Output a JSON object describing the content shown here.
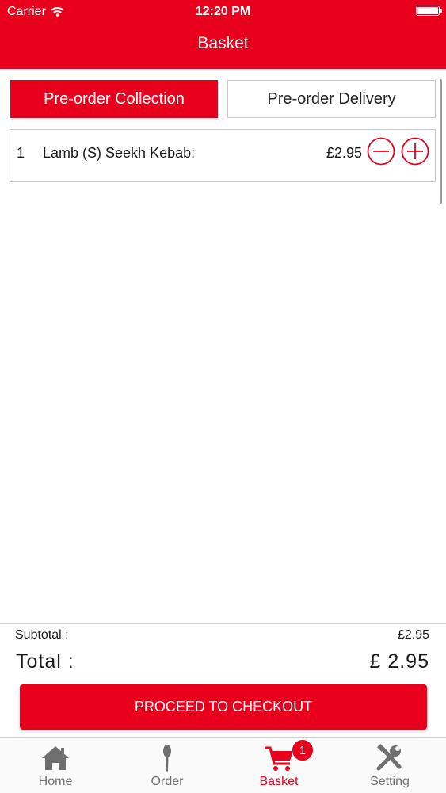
{
  "status_bar": {
    "carrier": "Carrier",
    "time": "12:20 PM"
  },
  "header": {
    "title": "Basket"
  },
  "mode_toggle": {
    "collection_label": "Pre-order Collection",
    "delivery_label": "Pre-order Delivery",
    "selected": "collection"
  },
  "basket": {
    "items": [
      {
        "quantity": "1",
        "name": "Lamb (S) Seekh Kebab:",
        "price": "£2.95"
      }
    ]
  },
  "summary": {
    "subtotal_label": "Subtotal :",
    "subtotal_value": "£2.95",
    "total_label": "Total :",
    "total_value": "£ 2.95"
  },
  "checkout": {
    "label": "PROCEED TO CHECKOUT"
  },
  "tab_bar": {
    "tabs": [
      {
        "label": "Home",
        "icon": "home-icon"
      },
      {
        "label": "Order",
        "icon": "spoon-icon"
      },
      {
        "label": "Basket",
        "icon": "cart-icon",
        "badge": "1",
        "active": true
      },
      {
        "label": "Setting",
        "icon": "tools-icon"
      }
    ]
  },
  "colors": {
    "accent": "#e8001c",
    "inactive_tab": "#6f6f6f"
  }
}
